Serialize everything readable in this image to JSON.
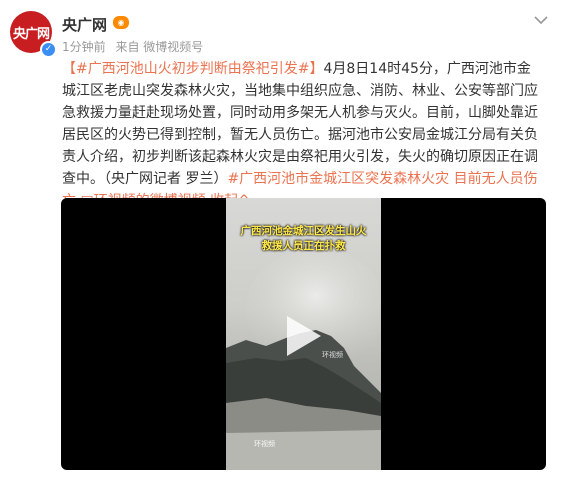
{
  "post": {
    "author": "央广网",
    "avatar_text": "央广网",
    "time": "1分钟前",
    "source": "来自 微博视频号",
    "topic1": "【#广西河池山火初步判断由祭祀引发#】",
    "body": "4月8日14时45分，广西河池市金城江区老虎山突发森林火灾，当地集中组织应急、消防、林业、公安等部门应急救援力量赶赴现场处置，同时动用多架无人机参与灭火。目前，山脚处靠近居民区的火势已得到控制，暂无人员伤亡。据河池市公安局金城江分局有关负责人介绍，初步判断该起森林火灾是由祭祀用火引发，失火的确切原因正在调查中。（央广网记者 罗兰）",
    "topic2": "#广西河池市金城江区突发森林火灾 目前无人员伤亡",
    "video_link": "□环视频的微博视频",
    "collapse": "收起^"
  },
  "video": {
    "caption_line1": "广西河池金城江区发生山火",
    "caption_line2": "救援人员正在扑救",
    "watermark": "环视频"
  },
  "colors": {
    "link": "#eb7350",
    "brand_red": "#c81e22"
  }
}
